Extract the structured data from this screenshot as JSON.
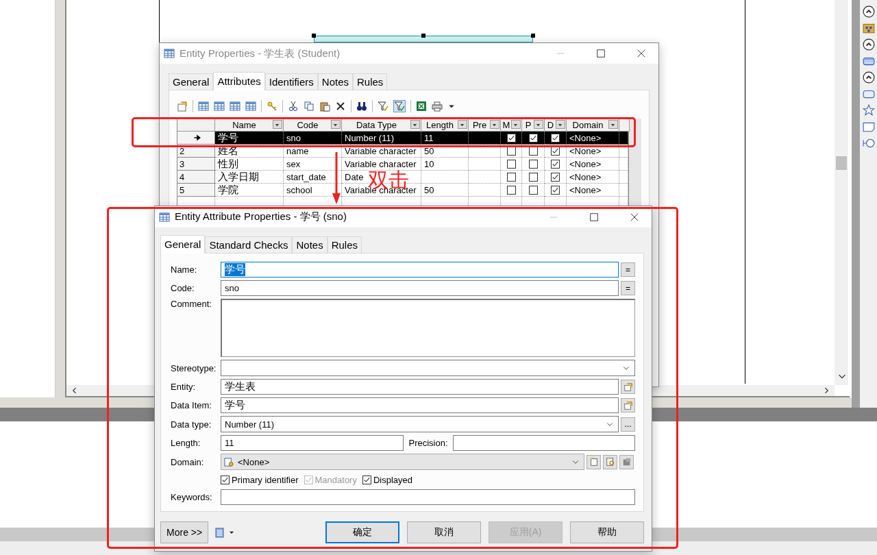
{
  "entity_window": {
    "title": "Entity Properties - 学生表 (Student)",
    "tabs": [
      {
        "label": "General",
        "selected": false
      },
      {
        "label": "Attributes",
        "selected": true
      },
      {
        "label": "Identifiers",
        "selected": false
      },
      {
        "label": "Notes",
        "selected": false
      },
      {
        "label": "Rules",
        "selected": false
      }
    ],
    "table": {
      "columns": [
        "Name",
        "Code",
        "Data Type",
        "Length",
        "Pre",
        "M",
        "P",
        "D",
        "Domain"
      ],
      "rows": [
        {
          "selected": true,
          "name": "学号",
          "code": "sno",
          "data_type": "Number (11)",
          "length": "11",
          "m": true,
          "p": true,
          "d": true,
          "domain": "<None>"
        },
        {
          "number": "2",
          "selected": false,
          "name": "姓名",
          "code": "name",
          "data_type": "Variable character",
          "length": "50",
          "m": false,
          "p": false,
          "d": true,
          "domain": "<None>"
        },
        {
          "number": "3",
          "selected": false,
          "name": "性别",
          "code": "sex",
          "data_type": "Variable character",
          "length": "10",
          "m": false,
          "p": false,
          "d": true,
          "domain": "<None>"
        },
        {
          "number": "4",
          "selected": false,
          "name": "入学日期",
          "code": "start_date",
          "data_type": "Date",
          "m": false,
          "p": false,
          "d": true,
          "domain": "<None>"
        },
        {
          "number": "5",
          "selected": false,
          "name": "学院",
          "code": "school",
          "data_type": "Variable character",
          "length": "50",
          "m": false,
          "p": false,
          "d": true,
          "domain": "<None>"
        }
      ]
    }
  },
  "attribute_window": {
    "title": "Entity Attribute Properties - 学号 (sno)",
    "tabs": [
      {
        "label": "General",
        "selected": true
      },
      {
        "label": "Standard Checks",
        "selected": false
      },
      {
        "label": "Notes",
        "selected": false
      },
      {
        "label": "Rules",
        "selected": false
      }
    ],
    "form": [
      {
        "kind": "text",
        "label": "Name:",
        "value": "学号",
        "highlighted": true,
        "button": "="
      },
      {
        "kind": "text",
        "label": "Code:",
        "value": "sno",
        "highlighted": false,
        "button": "="
      },
      {
        "kind": "textarea",
        "label": "Comment:"
      },
      {
        "kind": "select",
        "label": "Stereotype:"
      },
      {
        "kind": "lookup",
        "label": "Entity:",
        "value": "学生表"
      },
      {
        "kind": "lookup",
        "label": "Data Item:",
        "value": "学号"
      },
      {
        "kind": "select",
        "label": "Data type:",
        "value": "Number (11)",
        "button": "..."
      },
      {
        "kind": "pair",
        "label": "Length:",
        "value": "11",
        "label_2": "Precision:"
      },
      {
        "kind": "domain",
        "label": "Domain:",
        "value": "<None>"
      },
      {
        "kind": "checks",
        "checks": [
          {
            "label": "Primary identifier",
            "checked": true,
            "disabled": false
          },
          {
            "label": "Mandatory",
            "checked": true,
            "disabled": true
          },
          {
            "label": "Displayed",
            "checked": true,
            "disabled": false
          }
        ]
      },
      {
        "kind": "text",
        "label": "Keywords:",
        "highlighted": false
      }
    ],
    "buttons": [
      {
        "label": "确定",
        "default": true,
        "disabled": false
      },
      {
        "label": "取消",
        "default": false,
        "disabled": false
      },
      {
        "label": "应用(A)",
        "default": false,
        "disabled": true
      },
      {
        "label": "帮助",
        "default": false,
        "disabled": false
      }
    ],
    "more_button": "More >>"
  },
  "annotation": {
    "text": "双击"
  }
}
